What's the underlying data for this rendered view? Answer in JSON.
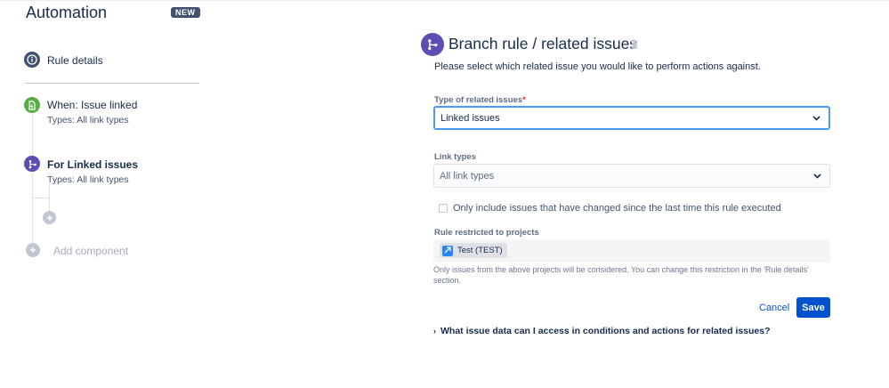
{
  "app": {
    "title": "Automation",
    "badge": "NEW"
  },
  "sidebar": {
    "rule_details": "Rule details",
    "steps": [
      {
        "title": "When: Issue linked",
        "subtitle": "Types: All link types",
        "icon": "trigger-icon",
        "color": "#5AAC44"
      },
      {
        "title": "For Linked issues",
        "subtitle": "Types: All link types",
        "icon": "branch-icon",
        "color": "#5E4DB2"
      }
    ],
    "add_component": "Add component"
  },
  "panel": {
    "title": "Branch rule / related issues",
    "description": "Please select which related issue you would like to perform actions against.",
    "type_field": {
      "label": "Type of related issues",
      "required_mark": "*",
      "value": "Linked issues"
    },
    "link_field": {
      "label": "Link types",
      "placeholder": "All link types"
    },
    "checkbox": {
      "label": "Only include issues that have changed since the last time this rule executed",
      "checked": false
    },
    "projects": {
      "label": "Rule restricted to projects",
      "chip": "Test (TEST)",
      "help": "Only issues from the above projects will be considered. You can change this restriction in the 'Rule details' section."
    },
    "buttons": {
      "cancel": "Cancel",
      "save": "Save"
    },
    "expander": "What issue data can I access in conditions and actions for related issues?"
  },
  "colors": {
    "primary": "#0052CC",
    "branch": "#5E4DB2",
    "trigger": "#5AAC44",
    "focus": "#4C9AFF",
    "required": "#DE350B"
  }
}
